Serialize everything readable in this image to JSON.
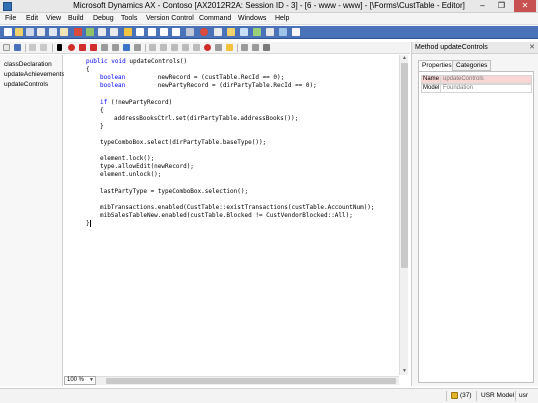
{
  "window": {
    "title": "Microsoft Dynamics AX - Contoso [AX2012R2A: Session ID - 3] - [6 - www - www] - [\\Forms\\CustTable - Editor]",
    "minimize": "–",
    "restore": "❐",
    "close": "✕"
  },
  "menu": [
    "File",
    "Edit",
    "View",
    "Build",
    "Debug",
    "Tools",
    "Version Control",
    "Command",
    "Windows",
    "Help"
  ],
  "methods": [
    "classDeclaration",
    "updateAchievements*",
    "updateControls"
  ],
  "code": [
    {
      "indent": 1,
      "tokens": [
        {
          "t": "public void",
          "k": 1
        },
        {
          "t": " updateControls()",
          "k": 0
        }
      ]
    },
    {
      "indent": 1,
      "tokens": [
        {
          "t": "{",
          "k": 0
        }
      ]
    },
    {
      "indent": 2,
      "tokens": [
        {
          "t": "boolean",
          "k": 1
        },
        {
          "t": "         newRecord = (custTable.RecId == 0);",
          "k": 0
        }
      ]
    },
    {
      "indent": 2,
      "tokens": [
        {
          "t": "boolean",
          "k": 1
        },
        {
          "t": "         newPartyRecord = (dirPartyTable.RecId == 0);",
          "k": 0
        }
      ]
    },
    {
      "indent": 0,
      "tokens": []
    },
    {
      "indent": 2,
      "tokens": [
        {
          "t": "if",
          "k": 1
        },
        {
          "t": " (!newPartyRecord)",
          "k": 0
        }
      ]
    },
    {
      "indent": 2,
      "tokens": [
        {
          "t": "{",
          "k": 0
        }
      ]
    },
    {
      "indent": 3,
      "tokens": [
        {
          "t": "addressBooksCtrl.set(dirPartyTable.addressBooks());",
          "k": 0
        }
      ]
    },
    {
      "indent": 2,
      "tokens": [
        {
          "t": "}",
          "k": 0
        }
      ]
    },
    {
      "indent": 0,
      "tokens": []
    },
    {
      "indent": 2,
      "tokens": [
        {
          "t": "typeComboBox.select(dirPartyTable.baseType());",
          "k": 0
        }
      ]
    },
    {
      "indent": 0,
      "tokens": []
    },
    {
      "indent": 2,
      "tokens": [
        {
          "t": "element.lock();",
          "k": 0
        }
      ]
    },
    {
      "indent": 2,
      "tokens": [
        {
          "t": "type.allowEdit(newRecord);",
          "k": 0
        }
      ]
    },
    {
      "indent": 2,
      "tokens": [
        {
          "t": "element.unlock();",
          "k": 0
        }
      ]
    },
    {
      "indent": 0,
      "tokens": []
    },
    {
      "indent": 2,
      "tokens": [
        {
          "t": "lastPartyType = typeComboBox.selection();",
          "k": 0
        }
      ]
    },
    {
      "indent": 0,
      "tokens": []
    },
    {
      "indent": 2,
      "tokens": [
        {
          "t": "mibTransactions.enabled(CustTable::existTransactions(custTable.AccountNum));",
          "k": 0
        }
      ]
    },
    {
      "indent": 2,
      "tokens": [
        {
          "t": "mibSalesTableNew.enabled(custTable.Blocked != CustVendorBlocked::All);",
          "k": 0
        }
      ]
    },
    {
      "indent": 1,
      "tokens": [
        {
          "t": "}",
          "k": 0
        }
      ]
    }
  ],
  "zoom": "100 %",
  "properties": {
    "title": "Method updateControls",
    "close": "✕",
    "tabs": [
      "Properties",
      "Categories"
    ],
    "rows": [
      {
        "key": "Name",
        "value": "updateControls"
      },
      {
        "key": "Model",
        "value": "Foundation"
      }
    ]
  },
  "status": {
    "count": "(37)",
    "model": "USR Model",
    "user": "usr"
  },
  "colors": {
    "keyword": "#0000ff",
    "toolbar": "#4a72b8",
    "selected_prop_row": "#f9d6d6",
    "selected_method": "#e4e4e4"
  }
}
